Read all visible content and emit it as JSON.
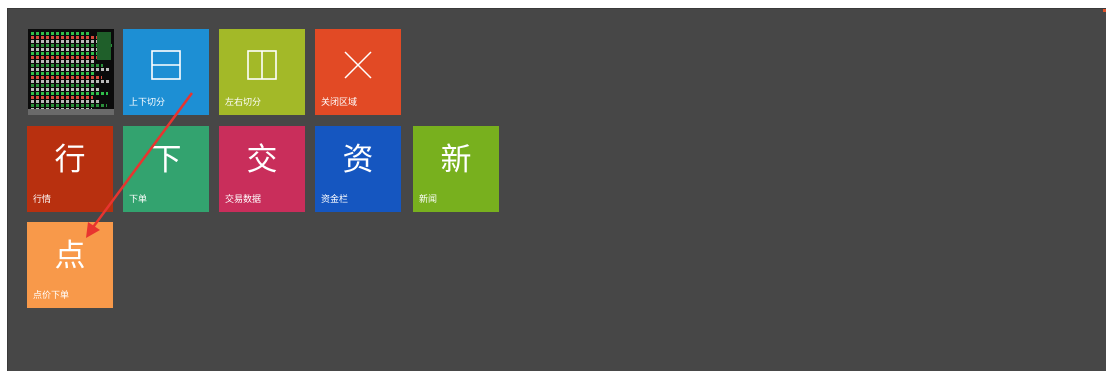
{
  "colors": {
    "background": "#474747",
    "tile_blue": "#1d8fd4",
    "tile_olive": "#a3b928",
    "tile_red": "#e24a25",
    "tile_darkred": "#b8300f",
    "tile_green": "#33a36f",
    "tile_crimson": "#c92e5b",
    "tile_navy": "#1556c0",
    "tile_lime": "#78b01e",
    "tile_orange": "#f8994a",
    "arrow": "#e8342f"
  },
  "tiles": {
    "split_vertical": {
      "label": "上下切分",
      "icon": "horizontal-split-icon"
    },
    "split_horizontal": {
      "label": "左右切分",
      "icon": "vertical-split-icon"
    },
    "close_area": {
      "label": "关闭区域",
      "icon": "close-icon"
    },
    "quotes": {
      "glyph": "行",
      "label": "行情"
    },
    "order": {
      "glyph": "下",
      "label": "下单"
    },
    "trade_data": {
      "glyph": "交",
      "label": "交易数据"
    },
    "funds": {
      "glyph": "资",
      "label": "资金栏"
    },
    "news": {
      "glyph": "新",
      "label": "新闻"
    },
    "click_order": {
      "glyph": "点",
      "label": "点价下单"
    }
  },
  "thumbnail": {
    "icon": "market-quote-preview-thumbnail"
  },
  "annotation": {
    "icon": "red-arrow-annotation"
  }
}
